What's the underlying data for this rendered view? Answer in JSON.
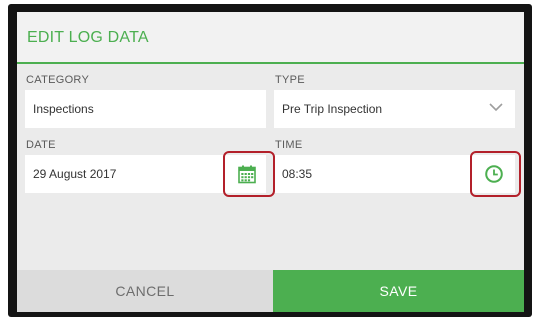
{
  "dialog": {
    "title": "EDIT LOG DATA"
  },
  "category": {
    "label": "CATEGORY",
    "value": "Inspections"
  },
  "type": {
    "label": "TYPE",
    "value": "Pre Trip Inspection",
    "icon": "chevron-down-icon"
  },
  "date": {
    "label": "DATE",
    "value": "29 August 2017",
    "icon": "calendar-icon"
  },
  "time": {
    "label": "TIME",
    "value": "08:35",
    "icon": "clock-icon"
  },
  "actions": {
    "cancel_label": "CANCEL",
    "save_label": "SAVE"
  },
  "colors": {
    "accent": "#4caf50",
    "highlight": "#b3202a",
    "cancel_bg": "#dcdcdc"
  }
}
